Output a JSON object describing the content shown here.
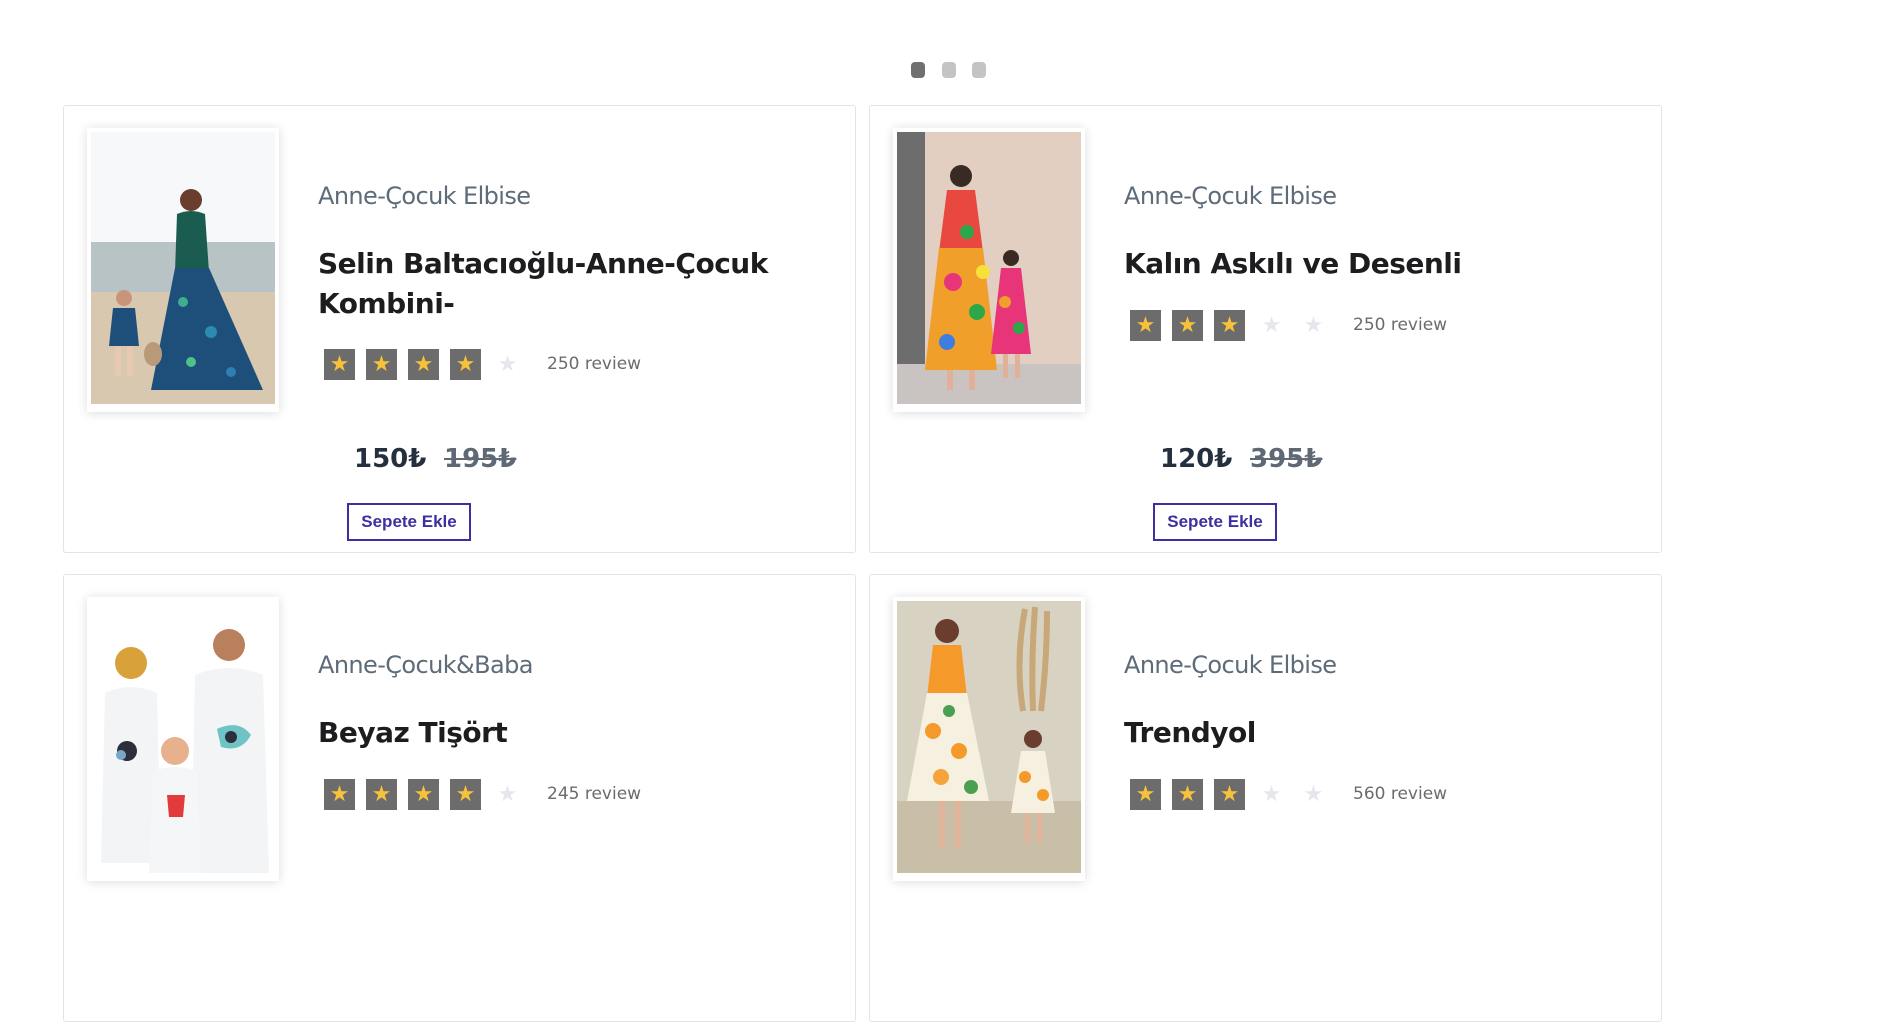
{
  "carousel": {
    "dots": 3,
    "active": 0
  },
  "products": [
    {
      "category": "Anne-Çocuk Elbise",
      "title": "Selin Baltacıoğlu-Anne-Çocuk Kombini-",
      "rating": 4,
      "max_rating": 5,
      "reviews": "250 review",
      "price": "150₺",
      "old_price": "195₺",
      "button": "Sepete Ekle",
      "image_alt": "mother and daughter in matching blue floral dresses on the beach"
    },
    {
      "category": "Anne-Çocuk Elbise",
      "title": "Kalın Askılı ve Desenli",
      "rating": 3,
      "max_rating": 5,
      "reviews": "250 review",
      "price": "120₺",
      "old_price": "395₺",
      "button": "Sepete Ekle",
      "image_alt": "mother and daughter in colorful floral maxi dresses"
    },
    {
      "category": "Anne-Çocuk&Baba",
      "title": "Beyaz Tişört",
      "rating": 4,
      "max_rating": 5,
      "reviews": "245 review",
      "image_alt": "family in white printed t-shirts"
    },
    {
      "category": "Anne-Çocuk Elbise",
      "title": "Trendyol",
      "rating": 3,
      "max_rating": 5,
      "reviews": "560 review",
      "image_alt": "mother and daughter in orange floral dresses"
    }
  ],
  "colors": {
    "star_fill": "#f6c23a",
    "star_box": "#6c6c6c",
    "star_off": "#e6e7ed",
    "button": "#3c2fa0",
    "dot_active": "#707070",
    "dot": "#c4c4c4"
  },
  "icons": {
    "star": "star-icon"
  }
}
